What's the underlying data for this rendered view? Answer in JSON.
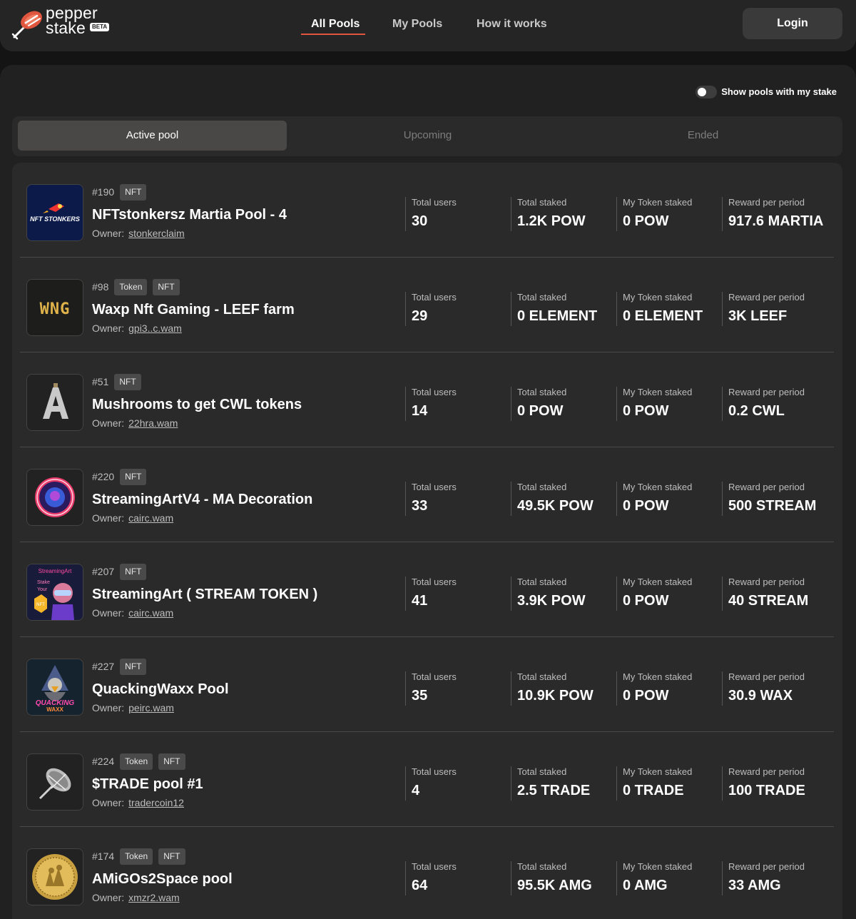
{
  "brand": {
    "line1": "pepper",
    "line2": "stake",
    "badge": "BETA"
  },
  "nav": {
    "items": [
      {
        "label": "All Pools",
        "active": true
      },
      {
        "label": "My Pools",
        "active": false
      },
      {
        "label": "How it works",
        "active": false
      }
    ]
  },
  "login_label": "Login",
  "filter": {
    "toggle_label": "Show pools with my stake",
    "enabled": false
  },
  "tabs": [
    {
      "label": "Active pool",
      "active": true
    },
    {
      "label": "Upcoming",
      "active": false
    },
    {
      "label": "Ended",
      "active": false
    }
  ],
  "stat_labels": {
    "users": "Total users",
    "staked": "Total staked",
    "my": "My Token staked",
    "reward": "Reward per period"
  },
  "owner_label": "Owner:",
  "pools": [
    {
      "id": "#190",
      "badges": [
        "NFT"
      ],
      "name": "NFTstonkersz Martia Pool - 4",
      "owner": "stonkerclaim",
      "users": "30",
      "staked": "1.2K POW",
      "my": "0 POW",
      "reward": "917.6 MARTIA",
      "icon": "nft-stonkers-logo-icon"
    },
    {
      "id": "#98",
      "badges": [
        "Token",
        "NFT"
      ],
      "name": "Waxp Nft Gaming - LEEF farm",
      "owner": "gpi3..c.wam",
      "users": "29",
      "staked": "0 ELEMENT",
      "my": "0 ELEMENT",
      "reward": "3K LEEF",
      "icon": "wng-logo-icon"
    },
    {
      "id": "#51",
      "badges": [
        "NFT"
      ],
      "name": "Mushrooms to get CWL tokens",
      "owner": "22hra.wam",
      "users": "14",
      "staked": "0 POW",
      "my": "0 POW",
      "reward": "0.2 CWL",
      "icon": "letter-a-logo-icon"
    },
    {
      "id": "#220",
      "badges": [
        "NFT"
      ],
      "name": "StreamingArtV4 - MA Decoration",
      "owner": "cairc.wam",
      "users": "33",
      "staked": "49.5K POW",
      "my": "0 POW",
      "reward": "500 STREAM",
      "icon": "streamingart-coin-icon"
    },
    {
      "id": "#207",
      "badges": [
        "NFT"
      ],
      "name": "StreamingArt ( STREAM TOKEN )",
      "owner": "cairc.wam",
      "users": "41",
      "staked": "3.9K POW",
      "my": "0 POW",
      "reward": "40 STREAM",
      "icon": "streamingart-poster-icon"
    },
    {
      "id": "#227",
      "badges": [
        "NFT"
      ],
      "name": "QuackingWaxx Pool",
      "owner": "peirc.wam",
      "users": "35",
      "staked": "10.9K POW",
      "my": "0 POW",
      "reward": "30.9 WAX",
      "icon": "quacking-waxx-duck-icon"
    },
    {
      "id": "#224",
      "badges": [
        "Token",
        "NFT"
      ],
      "name": "$TRADE pool #1",
      "owner": "tradercoin12",
      "users": "4",
      "staked": "2.5 TRADE",
      "my": "0 TRADE",
      "reward": "100 TRADE",
      "icon": "satellite-dish-icon"
    },
    {
      "id": "#174",
      "badges": [
        "Token",
        "NFT"
      ],
      "name": "AMiGOs2Space pool",
      "owner": "xmzr2.wam",
      "users": "64",
      "staked": "95.5K AMG",
      "my": "0 AMG",
      "reward": "33 AMG",
      "icon": "gold-coin-icon"
    }
  ],
  "colors": {
    "accent": "#e0553d",
    "background": "#141414",
    "panel": "#212121",
    "card": "#2a2a2a"
  }
}
